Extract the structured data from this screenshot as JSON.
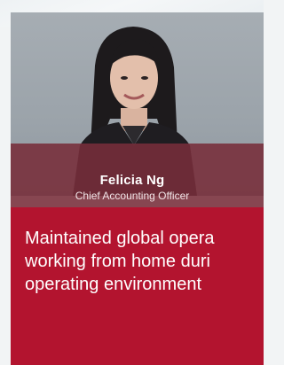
{
  "profile": {
    "name": "Felicia Ng",
    "title": "Chief Accounting Officer"
  },
  "quote": {
    "line1": "Maintained global opera",
    "line2": "working from home duri",
    "line3": "operating environment"
  },
  "colors": {
    "name_band": "#782d3a",
    "panel": "#b3142f",
    "text": "#ffffff"
  }
}
